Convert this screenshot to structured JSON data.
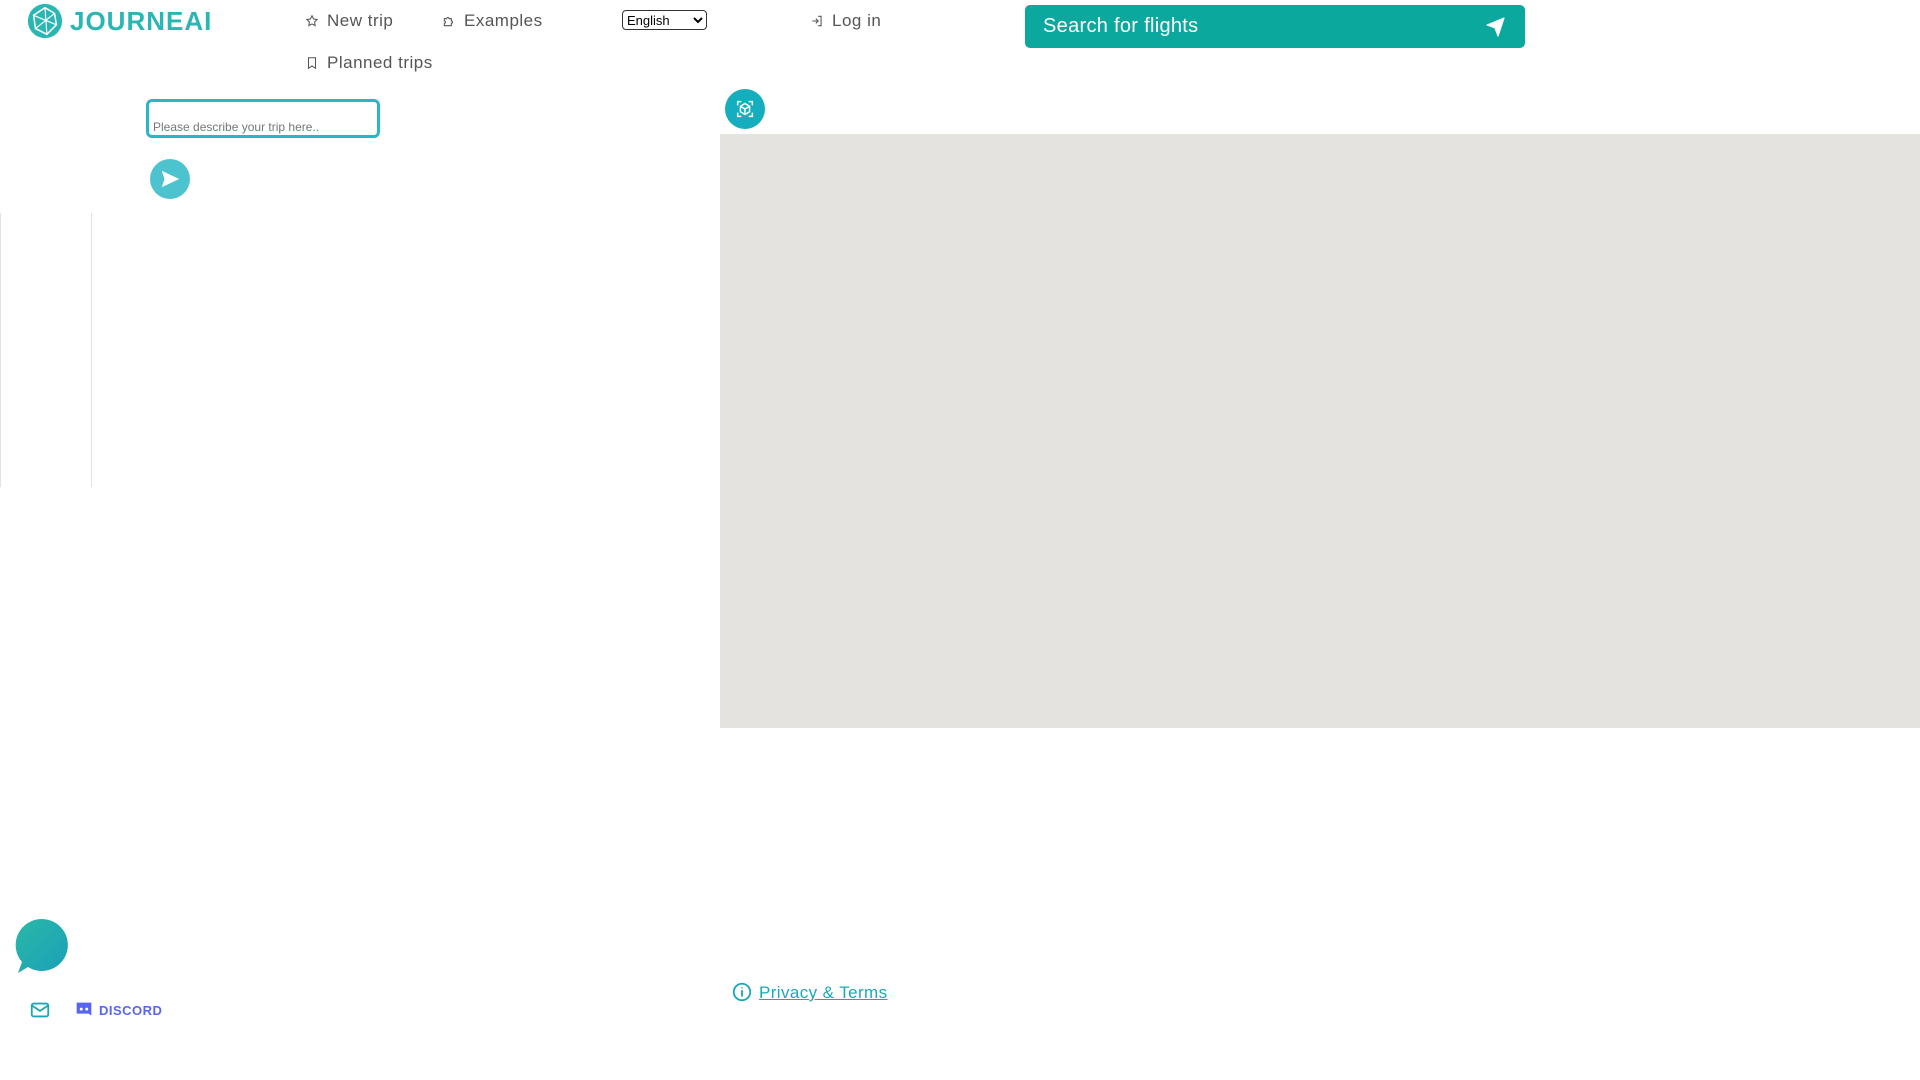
{
  "brand": {
    "name": "JOURNEAI",
    "color": "#2ab7b4"
  },
  "nav": {
    "new_trip": "New trip",
    "examples": "Examples",
    "planned_trips": "Planned trips",
    "log_in": "Log in",
    "language": {
      "selected": "English"
    }
  },
  "flights": {
    "label": "Search for flights",
    "color": "#0ba89d"
  },
  "trip": {
    "placeholder": "Please describe your trip here.."
  },
  "map": {
    "background": "#e5e3df"
  },
  "footer": {
    "discord_label": "DISCORD",
    "privacy_label": "Privacy & Terms"
  },
  "icons": [
    "logo-icon",
    "star-icon",
    "puzzle-icon",
    "bookmark-icon",
    "login-icon",
    "airplane-icon",
    "send-icon",
    "ar-cube-icon",
    "chat-icon",
    "mail-icon",
    "discord-icon",
    "info-icon"
  ]
}
